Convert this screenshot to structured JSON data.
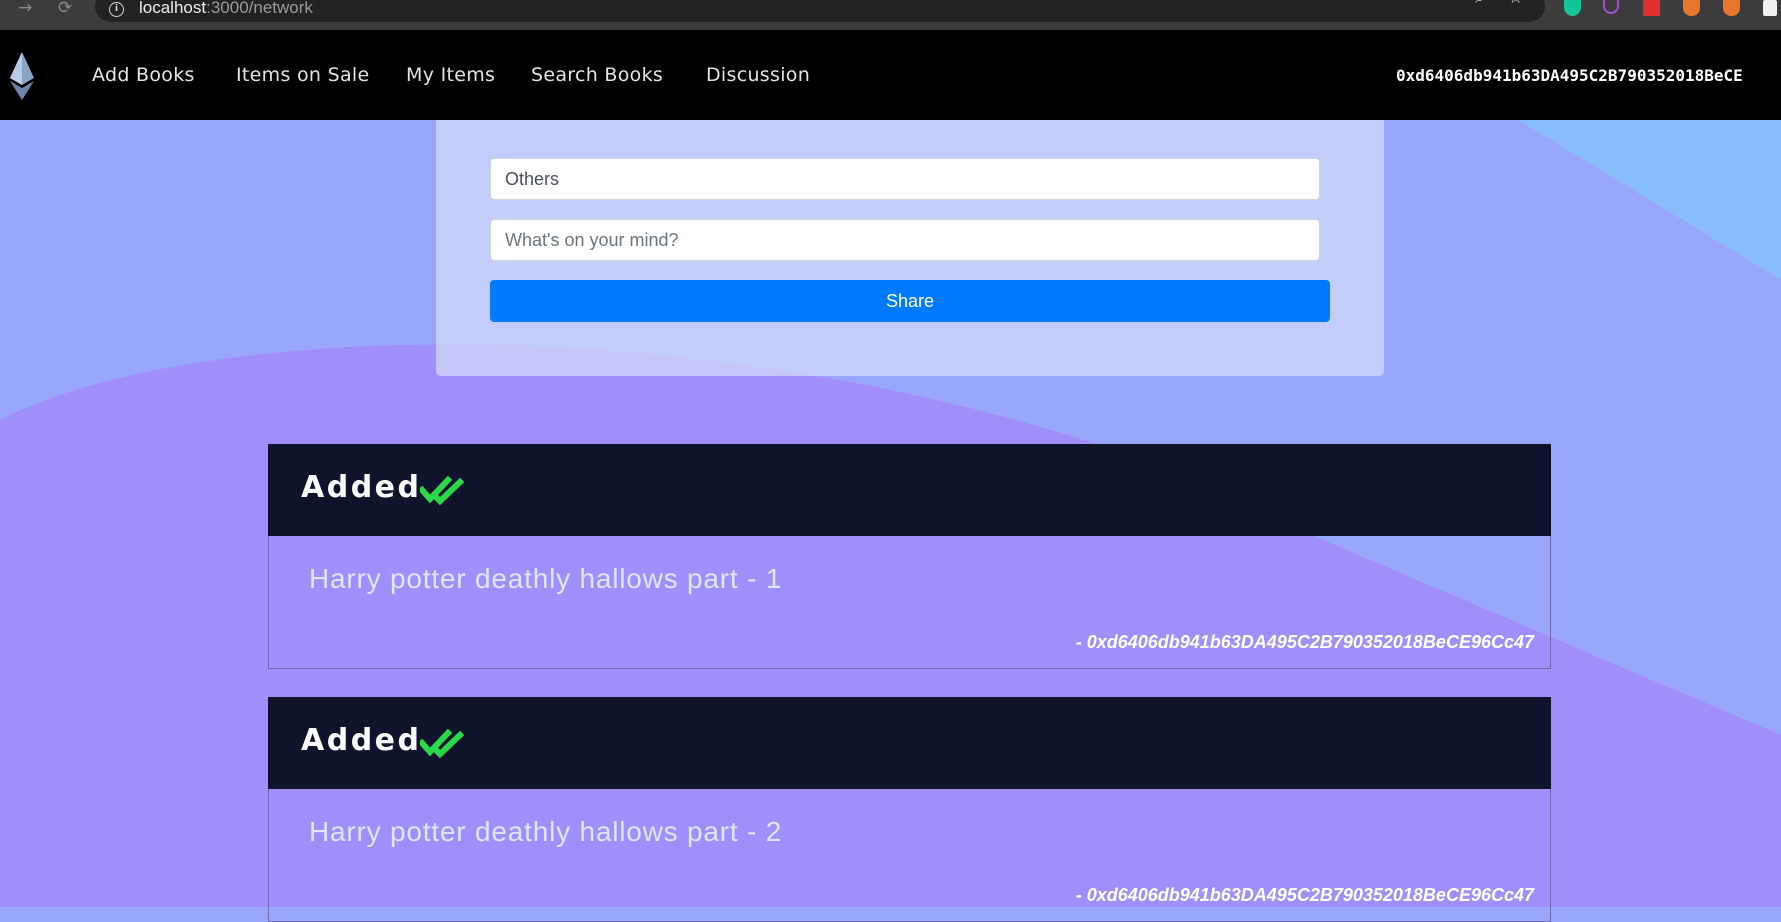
{
  "browser": {
    "url_host": "localhost",
    "url_path": ":3000/network",
    "icons": [
      "back-arrow-icon",
      "reload-icon",
      "site-info-icon",
      "zoom-icon",
      "bookmark-star-icon"
    ],
    "extension_colors": [
      "#2ecc71",
      "#a44fd9",
      "#e03131",
      "#e8772e",
      "#e8772e",
      "#f0f0f0"
    ]
  },
  "navbar": {
    "logo": "ethereum-icon",
    "links": [
      "Add Books",
      "Items on Sale",
      "My Items",
      "Search Books",
      "Discussion"
    ],
    "account": "0xd6406db941b63DA495C2B790352018BeCE"
  },
  "form": {
    "category_value": "Others",
    "message_placeholder": "What's on your mind?",
    "share_label": "Share"
  },
  "posts": [
    {
      "status": "Added",
      "status_icon": "double-check-icon",
      "text": "Harry potter deathly hallows part - 1",
      "author": "- 0xd6406db941b63DA495C2B790352018BeCE96Cc47"
    },
    {
      "status": "Added",
      "status_icon": "double-check-icon",
      "text": "Harry potter deathly hallows part - 2",
      "author": "- 0xd6406db941b63DA495C2B790352018BeCE96Cc47"
    }
  ],
  "colors": {
    "navbar_bg": "#000000",
    "card_header_bg": "#0f132c",
    "share_button": "#007bff",
    "check_icon": "#2bd84a",
    "bg_purple": "#a08ffb",
    "bg_blue": "#98a7fb"
  }
}
